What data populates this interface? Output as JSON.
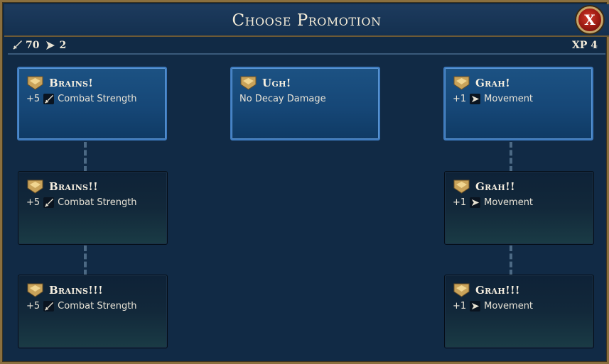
{
  "window": {
    "title": "Choose Promotion",
    "close_label": "X"
  },
  "stats": {
    "strength": "70",
    "movement": "2",
    "xp": "XP 4"
  },
  "cards": [
    {
      "title": "Brains!",
      "body_prefix": "+5",
      "body_text": "Combat Strength",
      "icon": "sword-icon",
      "state": "active"
    },
    {
      "title": "Ugh!",
      "body_prefix": "",
      "body_text": "No Decay Damage",
      "icon": "",
      "state": "active"
    },
    {
      "title": "Grah!",
      "body_prefix": "+1",
      "body_text": "Movement",
      "icon": "arrow-icon",
      "state": "active"
    },
    {
      "title": "Brains!!",
      "body_prefix": "+5",
      "body_text": "Combat Strength",
      "icon": "sword-icon",
      "state": "locked"
    },
    {
      "title": "Grah!!",
      "body_prefix": "+1",
      "body_text": "Movement",
      "icon": "arrow-icon",
      "state": "locked"
    },
    {
      "title": "Brains!!!",
      "body_prefix": "+5",
      "body_text": "Combat Strength",
      "icon": "sword-icon",
      "state": "locked"
    },
    {
      "title": "Grah!!!",
      "body_prefix": "+1",
      "body_text": "Movement",
      "icon": "arrow-icon",
      "state": "locked"
    }
  ],
  "colors": {
    "gold": "#c9a35a",
    "active_border": "#3f7cc0",
    "close_red": "#c0281c"
  }
}
